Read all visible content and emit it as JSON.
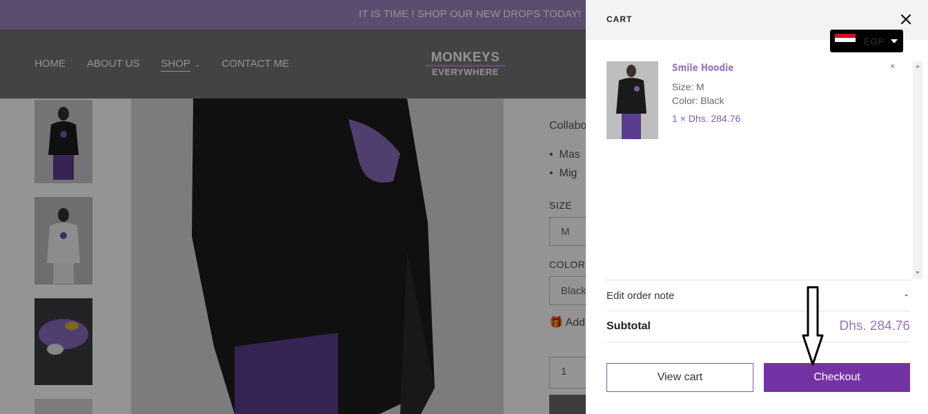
{
  "announcement": "IT IS TIME ! SHOP OUR NEW DROPS TODAY!",
  "nav": {
    "items": [
      "HOME",
      "ABOUT US",
      "SHOP",
      "CONTACT ME"
    ],
    "shop_caret_icon": "chevron-down-icon"
  },
  "logo": {
    "line1": "MONKEYS",
    "line2": "EVERYWHERE"
  },
  "product_info": {
    "desc_partial": "Collabo",
    "bullets": [
      "Mas",
      "Mig"
    ],
    "size_label": "SIZE",
    "size_value": "M",
    "color_label": "COLOR",
    "color_value": "Black",
    "add_label": "Add",
    "quantity": "1"
  },
  "cart": {
    "title": "CART",
    "close_icon": "close-icon",
    "currency": {
      "code": "EGP",
      "flag": "egypt-flag-icon"
    },
    "item": {
      "name": "Smile Hoodie",
      "size": "Size: M",
      "color": "Color: Black",
      "price_line": "1 × Dhs. 284.76",
      "remove": "×"
    },
    "order_note": "Edit order note",
    "subtotal_label": "Subtotal",
    "subtotal_value": "Dhs. 284.76",
    "view_cart": "View cart",
    "checkout": "Checkout"
  },
  "colors": {
    "announcement_bg": "#9d86bf",
    "accent": "#7433a5",
    "price": "#9a71b9"
  }
}
